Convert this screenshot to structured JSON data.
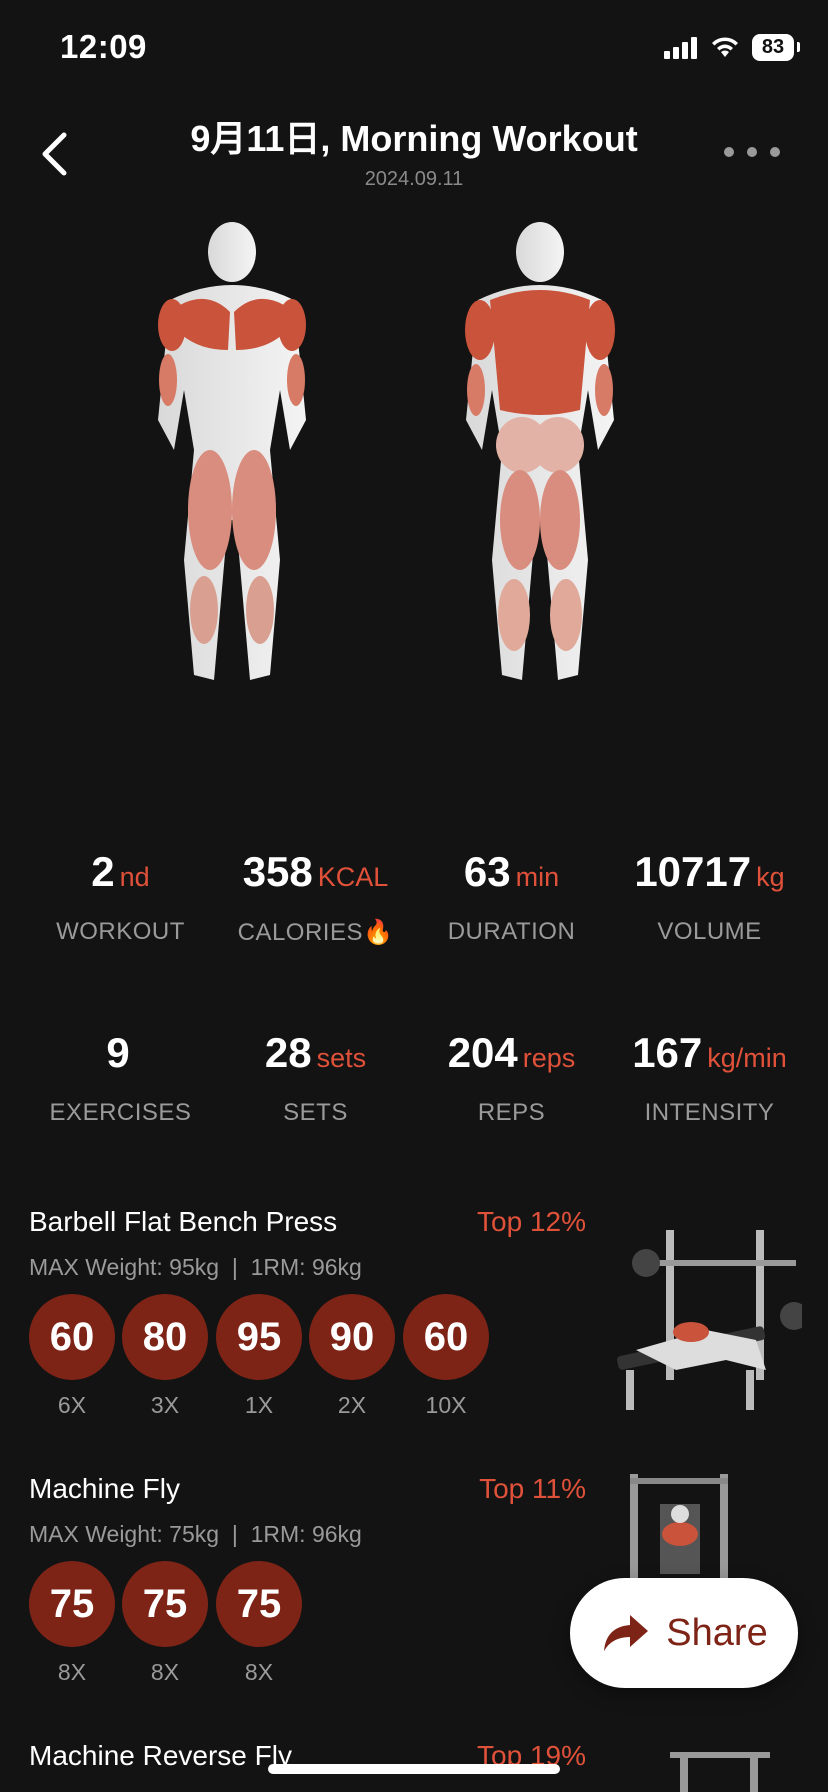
{
  "status_bar": {
    "time": "12:09",
    "battery": "83"
  },
  "header": {
    "title": "9月11日, Morning Workout",
    "date": "2024.09.11"
  },
  "stats_row1": [
    {
      "value": "2",
      "unit": "nd",
      "label": "WORKOUT"
    },
    {
      "value": "358",
      "unit": "KCAL",
      "label": "CALORIES🔥"
    },
    {
      "value": "63",
      "unit": "min",
      "label": "DURATION"
    },
    {
      "value": "10717",
      "unit": "kg",
      "label": "VOLUME"
    }
  ],
  "stats_row2": [
    {
      "value": "9",
      "unit": "",
      "label": "EXERCISES"
    },
    {
      "value": "28",
      "unit": "sets",
      "label": "SETS"
    },
    {
      "value": "204",
      "unit": "reps",
      "label": "REPS"
    },
    {
      "value": "167",
      "unit": "kg/min",
      "label": "INTENSITY"
    }
  ],
  "exercises": [
    {
      "name": "Barbell Flat Bench Press",
      "top": "Top 12%",
      "max_weight": "MAX Weight: 95kg",
      "one_rm": "1RM: 96kg",
      "sets": [
        {
          "weight": "60",
          "reps": "6X"
        },
        {
          "weight": "80",
          "reps": "3X"
        },
        {
          "weight": "95",
          "reps": "1X"
        },
        {
          "weight": "90",
          "reps": "2X"
        },
        {
          "weight": "60",
          "reps": "10X"
        }
      ]
    },
    {
      "name": "Machine Fly",
      "top": "Top 11%",
      "max_weight": "MAX Weight: 75kg",
      "one_rm": "1RM: 96kg",
      "sets": [
        {
          "weight": "75",
          "reps": "8X"
        },
        {
          "weight": "75",
          "reps": "8X"
        },
        {
          "weight": "75",
          "reps": "8X"
        }
      ]
    },
    {
      "name": "Machine Reverse Fly",
      "top": "Top 19%"
    }
  ],
  "share": {
    "label": "Share"
  },
  "colors": {
    "background": "#131313",
    "accent": "#e0513a",
    "set_circle": "#7e2417"
  },
  "icons": [
    "back-chevron-icon",
    "more-dots-icon",
    "signal-icon",
    "wifi-icon",
    "battery-icon",
    "share-arrow-icon"
  ]
}
